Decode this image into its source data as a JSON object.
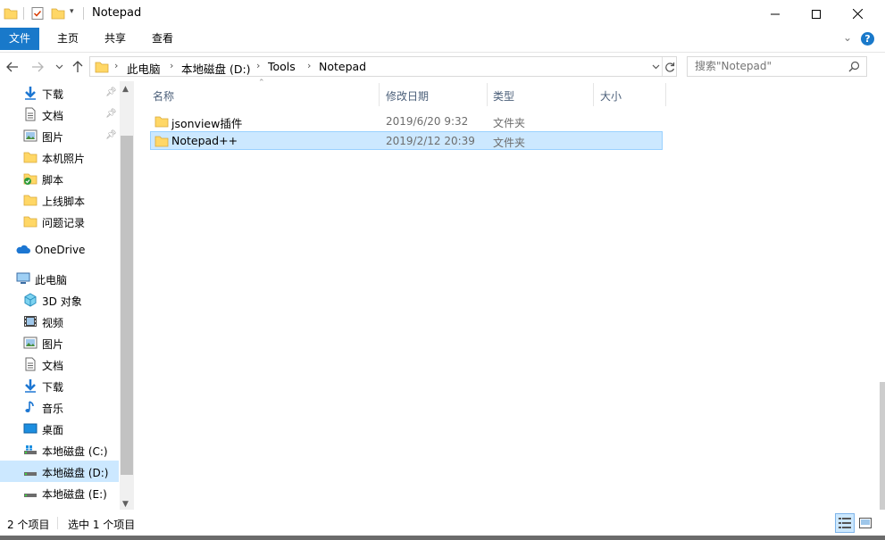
{
  "window": {
    "title": "Notepad",
    "minimize_icon": "minimize-icon",
    "maximize_icon": "maximize-icon",
    "close_icon": "close-icon"
  },
  "ribbon": {
    "tabs": [
      {
        "label": "文件"
      },
      {
        "label": "主页"
      },
      {
        "label": "共享"
      },
      {
        "label": "查看"
      }
    ]
  },
  "address": {
    "crumbs": [
      "此电脑",
      "本地磁盘 (D:)",
      "Tools",
      "Notepad"
    ]
  },
  "search": {
    "placeholder": "搜索\"Notepad\""
  },
  "nav": {
    "items": [
      {
        "label": "下载",
        "icon": "download-icon",
        "pinned": true
      },
      {
        "label": "文档",
        "icon": "document-icon",
        "pinned": true
      },
      {
        "label": "图片",
        "icon": "picture-icon",
        "pinned": true
      },
      {
        "label": "本机照片",
        "icon": "folder-icon",
        "pinned": false
      },
      {
        "label": "脚本",
        "icon": "folder-check-icon",
        "pinned": false
      },
      {
        "label": "上线脚本",
        "icon": "folder-icon",
        "pinned": false
      },
      {
        "label": "问题记录",
        "icon": "folder-icon",
        "pinned": false
      },
      {
        "label": "OneDrive",
        "icon": "cloud-icon",
        "pinned": false
      },
      {
        "label": "此电脑",
        "icon": "computer-icon",
        "pinned": false
      },
      {
        "label": "3D 对象",
        "icon": "cube-icon",
        "pinned": false
      },
      {
        "label": "视频",
        "icon": "video-icon",
        "pinned": false
      },
      {
        "label": "图片",
        "icon": "picture-icon",
        "pinned": false
      },
      {
        "label": "文档",
        "icon": "document-icon",
        "pinned": false
      },
      {
        "label": "下载",
        "icon": "download-icon",
        "pinned": false
      },
      {
        "label": "音乐",
        "icon": "music-icon",
        "pinned": false
      },
      {
        "label": "桌面",
        "icon": "desktop-icon",
        "pinned": false
      },
      {
        "label": "本地磁盘 (C:)",
        "icon": "drive-icon",
        "pinned": false
      },
      {
        "label": "本地磁盘 (D:)",
        "icon": "drive-icon",
        "pinned": false,
        "selected": true
      },
      {
        "label": "本地磁盘 (E:)",
        "icon": "drive-icon",
        "pinned": false
      }
    ]
  },
  "columns": {
    "name": "名称",
    "date": "修改日期",
    "type": "类型",
    "size": "大小"
  },
  "files": [
    {
      "name": "jsonview插件",
      "date": "2019/6/20 9:32",
      "type": "文件夹",
      "selected": false
    },
    {
      "name": "Notepad++",
      "date": "2019/2/12 20:39",
      "type": "文件夹",
      "selected": true
    }
  ],
  "status": {
    "count": "2 个项目",
    "selected": "选中 1 个项目"
  },
  "colors": {
    "accent": "#1979ca",
    "selection": "#cce8ff",
    "folder": "#ffd766"
  }
}
